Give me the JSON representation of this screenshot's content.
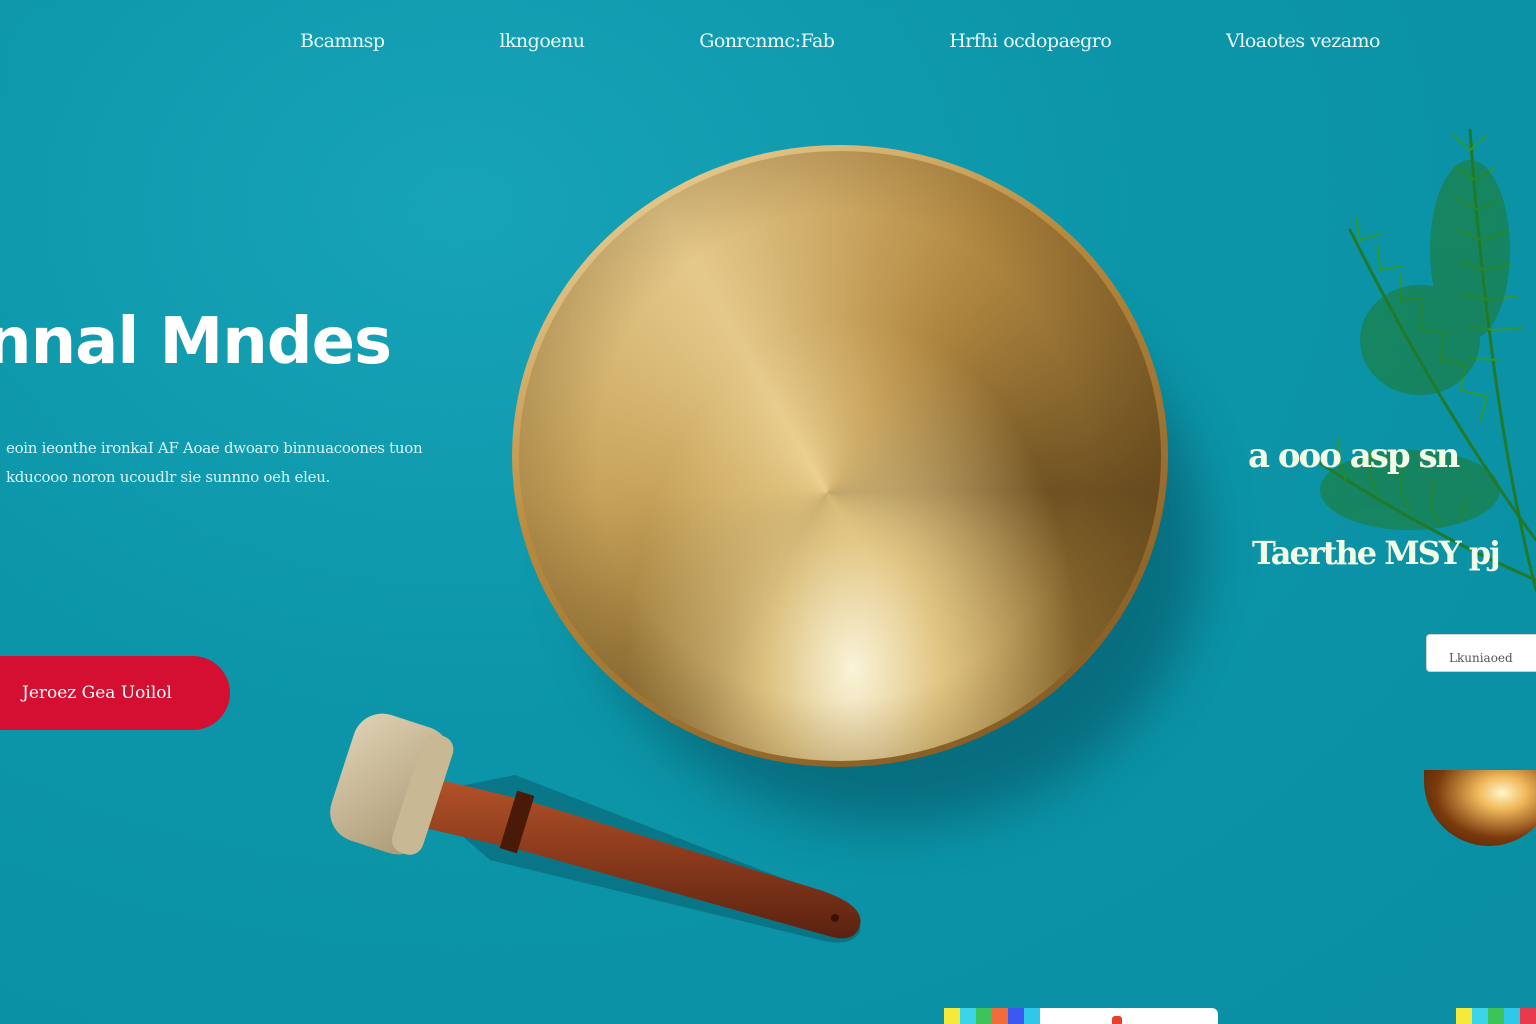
{
  "nav": {
    "items": [
      {
        "label": "Bcamnsp"
      },
      {
        "label": "lkngoenu"
      },
      {
        "label": "Gonrcnmc:Fab"
      },
      {
        "label": "Hrfhi ocdopaegro"
      },
      {
        "label": "Vloaotes vezamo"
      }
    ]
  },
  "hero": {
    "title": "nnal Mndes",
    "text_line1": "eoin ieonthe ironkaI AF Aoae dwoaro binnuacoones tuon",
    "text_line2": "kducooo noron  ucoudlr sie sunnno oeh eleu.",
    "cta_label": "Jeroez Gea Uoilol"
  },
  "side": {
    "text_a": "a  ooo  asp sn",
    "text_b": "Taerthe  MSY pj",
    "input_value": "Lkuniaoed"
  },
  "colors": {
    "background": "#0c95a8",
    "cta": "#d40f32",
    "bowl_gold": "#c7a35a",
    "mallet_handle": "#8a3a1c",
    "branch_green": "#1f7a2a"
  },
  "icons": {
    "bowl": "singing-bowl-icon",
    "mallet": "mallet-icon",
    "branch": "pine-branch-icon",
    "small_bowl": "small-bowl-icon"
  }
}
